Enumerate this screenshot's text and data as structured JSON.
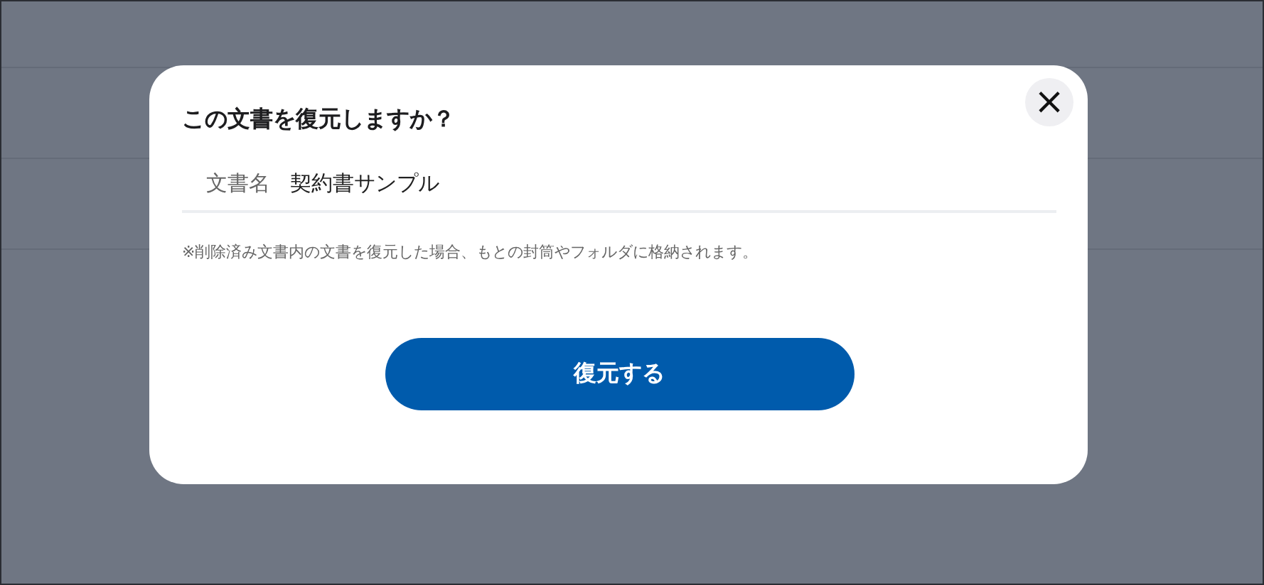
{
  "dialog": {
    "title": "この文書を復元しますか？",
    "close_button": "×",
    "field": {
      "label": "文書名",
      "value": "契約書サンプル"
    },
    "note": "※削除済み文書内の文書を復元した場合、もとの封筒やフォルダに格納されます。",
    "confirm_button": "復元する"
  }
}
